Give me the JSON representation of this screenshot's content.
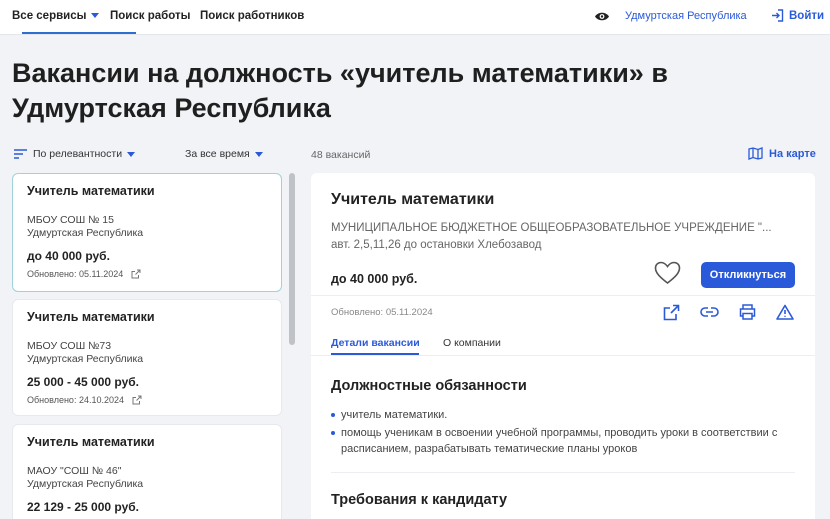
{
  "header": {
    "services_label": "Все сервисы",
    "nav": [
      "Поиск работы",
      "Поиск работников"
    ],
    "region": "Удмуртская Республика",
    "login_label": "Войти"
  },
  "page": {
    "title": "Вакансии на должность «учитель математики» в Удмуртская Республика"
  },
  "filters": {
    "sort_label": "По релевантности",
    "period_label": "За все время",
    "count_label": "48 вакансий",
    "map_label": "На карте"
  },
  "vacancies": [
    {
      "title": "Учитель математики",
      "org": "МБОУ СОШ № 15",
      "region": "Удмуртская Республика",
      "salary": "до 40 000 руб.",
      "updated": "Обновлено: 05.11.2024"
    },
    {
      "title": "Учитель математики",
      "org": "МБОУ СОШ №73",
      "region": "Удмуртская Республика",
      "salary": "25 000 - 45 000 руб.",
      "updated": "Обновлено: 24.10.2024"
    },
    {
      "title": "Учитель математики",
      "org": "МАОУ \"СОШ № 46\"",
      "region": "Удмуртская Республика",
      "salary": "22 129 - 25 000 руб.",
      "updated": ""
    }
  ],
  "detail": {
    "title": "Учитель математики",
    "org": "МУНИЦИПАЛЬНОЕ БЮДЖЕТНОЕ ОБЩЕОБРАЗОВАТЕЛЬНОЕ УЧРЕЖДЕНИЕ \"...",
    "address": "авт. 2,5,11,26 до остановки Хлебозавод",
    "salary": "до 40 000 руб.",
    "apply_label": "Откликнуться",
    "updated": "Обновлено: 05.11.2024",
    "tabs": [
      "Детали вакансии",
      "О компании"
    ],
    "duties_heading": "Должностные обязанности",
    "duties": [
      "учитель математики.",
      "помощь ученикам в освоении учебной программы, проводить уроки в соответствии с расписанием, разрабатывать тематические планы уроков"
    ],
    "requirements_heading": "Требования к кандидату"
  },
  "colors": {
    "accent": "#2a5ad9",
    "active_border": "#9fd3d8"
  }
}
